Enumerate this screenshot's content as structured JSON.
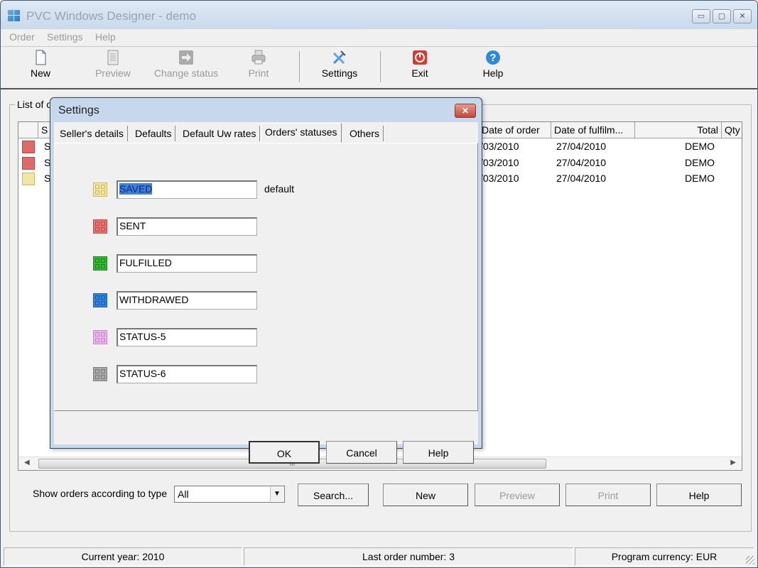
{
  "window": {
    "title": "PVC Windows Designer - demo",
    "controls": {
      "minimize": "▭",
      "maximize": "▢",
      "close": "✕"
    }
  },
  "menu": [
    {
      "label": "Order"
    },
    {
      "label": "Settings"
    },
    {
      "label": "Help"
    }
  ],
  "toolbar": [
    {
      "label": "New",
      "icon": "new-document-icon",
      "enabled": true
    },
    {
      "label": "Preview",
      "icon": "preview-icon",
      "enabled": false
    },
    {
      "label": "Change status",
      "icon": "change-status-icon",
      "enabled": false
    },
    {
      "label": "Print",
      "icon": "printer-icon",
      "enabled": false
    },
    {
      "label": "Settings",
      "icon": "tools-icon",
      "enabled": true
    },
    {
      "label": "Exit",
      "icon": "power-icon",
      "enabled": true
    },
    {
      "label": "Help",
      "icon": "help-icon",
      "enabled": true
    }
  ],
  "orders": {
    "group_label": "List of orders",
    "columns": [
      "",
      "S",
      "Date of order",
      "Date of fulfilm...",
      "Total",
      "Qty"
    ],
    "rows": [
      {
        "status_color": "#e06a6a",
        "status": "S",
        "date_of_order": "/03/2010",
        "date_of_fulfilment": "27/04/2010",
        "total": "DEMO"
      },
      {
        "status_color": "#e06a6a",
        "status": "S",
        "date_of_order": "/03/2010",
        "date_of_fulfilment": "27/04/2010",
        "total": "DEMO"
      },
      {
        "status_color": "#f1e6a4",
        "status": "S",
        "date_of_order": "/03/2010",
        "date_of_fulfilment": "27/04/2010",
        "total": "DEMO"
      }
    ],
    "scroll_grip": "III",
    "filter_label": "Show orders according to type",
    "filter_value": "All",
    "buttons": [
      {
        "label": "Search...",
        "enabled": true
      },
      {
        "label": "New",
        "enabled": true
      },
      {
        "label": "Preview",
        "enabled": false
      },
      {
        "label": "Print",
        "enabled": false
      },
      {
        "label": "Help",
        "enabled": true
      }
    ]
  },
  "statusbar": {
    "current_year": "Current year: 2010",
    "last_order": "Last order number: 3",
    "currency": "Program currency: EUR"
  },
  "dialog": {
    "title": "Settings",
    "close": "✕",
    "tabs": [
      {
        "label": "Seller's details",
        "active": false
      },
      {
        "label": "Defaults",
        "active": false
      },
      {
        "label": "Default Uw rates",
        "active": false
      },
      {
        "label": "Orders' statuses",
        "active": true
      },
      {
        "label": "Others",
        "active": false
      }
    ],
    "statuses": [
      {
        "name": "SAVED",
        "color": "#f1e6a4",
        "border": "#c9b968",
        "default": true
      },
      {
        "name": "SENT",
        "color": "#e67575",
        "border": "#c24a4a",
        "default": false
      },
      {
        "name": "FULFILLED",
        "color": "#35b835",
        "border": "#1a861a",
        "default": false
      },
      {
        "name": "WITHDRAWED",
        "color": "#2e86de",
        "border": "#1a5aa8",
        "default": false
      },
      {
        "name": "STATUS-5",
        "color": "#ebb5ec",
        "border": "#c58ac7",
        "default": false
      },
      {
        "name": "STATUS-6",
        "color": "#a8a8a8",
        "border": "#7d7d7d",
        "default": false
      }
    ],
    "default_label": "default",
    "buttons": {
      "ok": "OK",
      "cancel": "Cancel",
      "help": "Help"
    }
  }
}
